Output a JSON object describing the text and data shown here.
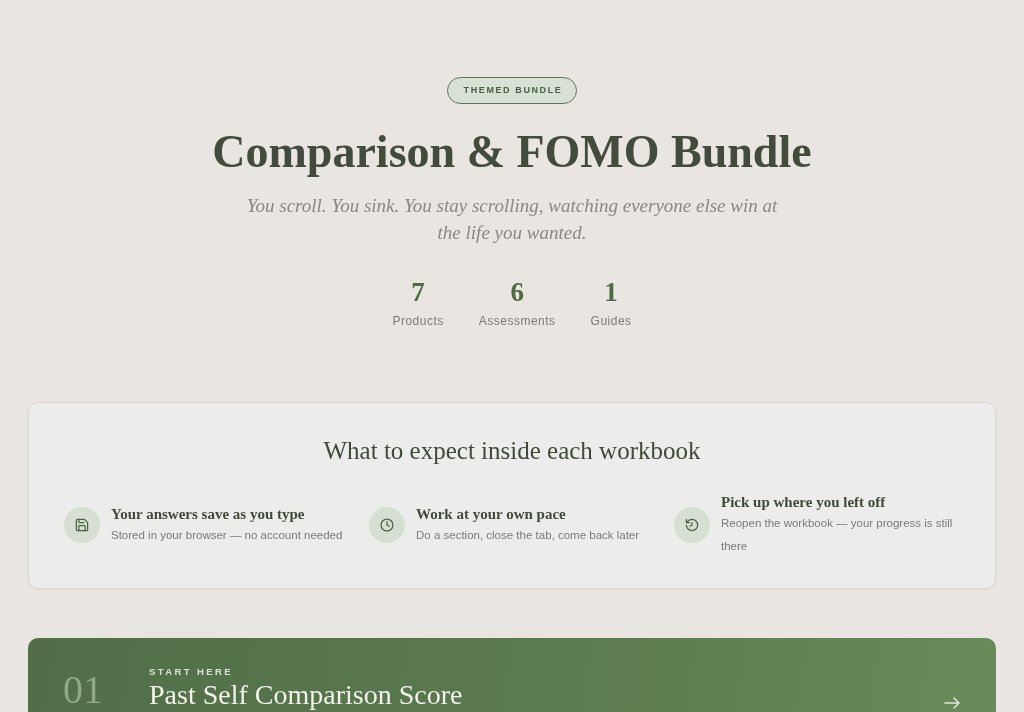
{
  "badge": {
    "label": "THEMED BUNDLE"
  },
  "title": "Comparison & FOMO Bundle",
  "subtitle": "You scroll. You sink. You stay scrolling, watching everyone else win at the life you wanted.",
  "stats": [
    {
      "value": "7",
      "label": "Products"
    },
    {
      "value": "6",
      "label": "Assessments"
    },
    {
      "value": "1",
      "label": "Guides"
    }
  ],
  "expectations": {
    "heading": "What to expect inside each workbook",
    "items": [
      {
        "title": "Your answers save as you type",
        "description": "Stored in your browser — no account needed"
      },
      {
        "title": "Work at your own pace",
        "description": "Do a section, close the tab, come back later"
      },
      {
        "title": "Pick up where you left off",
        "description": "Reopen the workbook — your progress is still there"
      }
    ]
  },
  "products": [
    {
      "number": "01",
      "eyebrow": "START HERE",
      "title": "Past Self Comparison Score"
    }
  ]
}
